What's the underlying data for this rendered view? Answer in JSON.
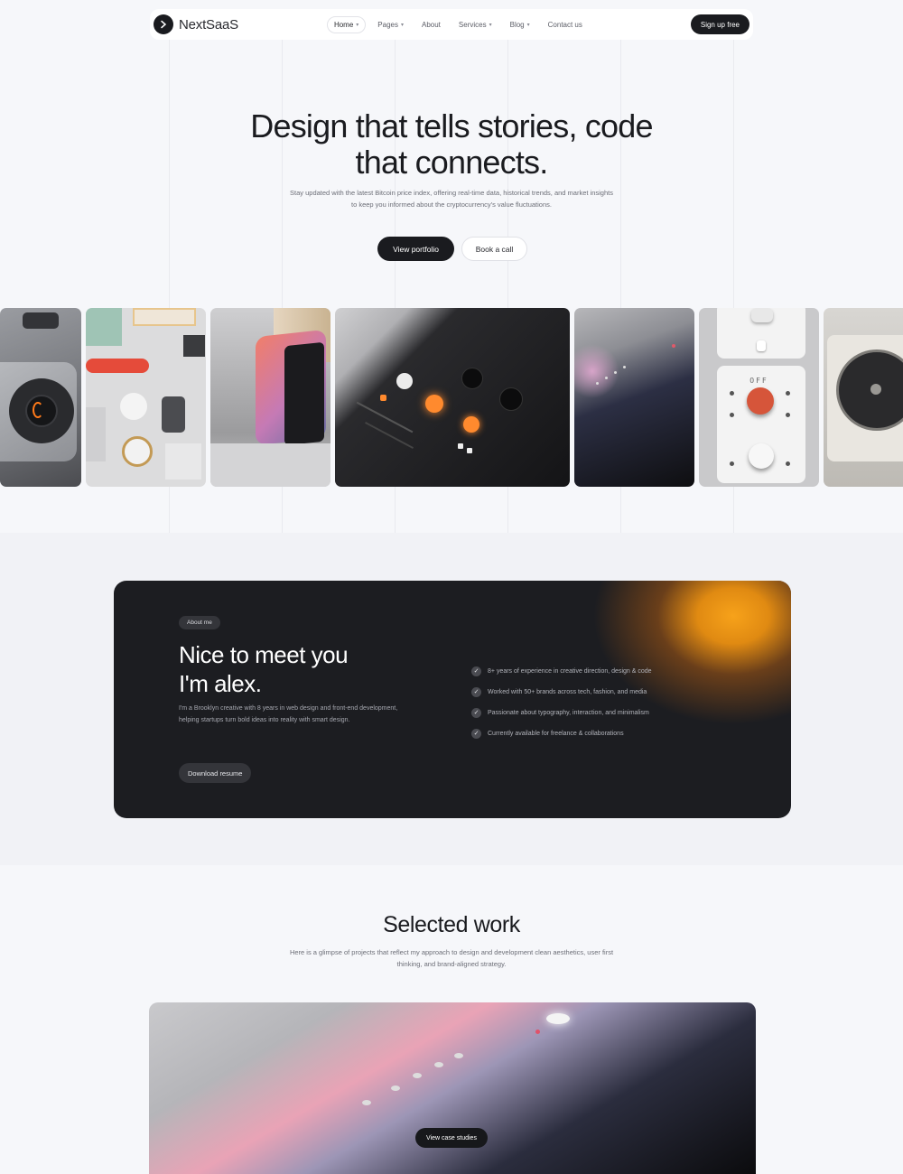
{
  "nav": {
    "logo_text": "NextSaaS",
    "items": [
      {
        "label": "Home",
        "has_dropdown": true,
        "active": true
      },
      {
        "label": "Pages",
        "has_dropdown": true
      },
      {
        "label": "About",
        "has_dropdown": false
      },
      {
        "label": "Services",
        "has_dropdown": true
      },
      {
        "label": "Blog",
        "has_dropdown": true
      },
      {
        "label": "Contact us",
        "has_dropdown": false
      }
    ],
    "cta_label": "Sign up free"
  },
  "hero": {
    "title_line1": "Design that tells stories, code",
    "title_line2": "that connects.",
    "subtitle": "Stay updated with the latest Bitcoin price index, offering real-time data, historical trends, and market insights to keep you informed about the cryptocurrency's value fluctuations.",
    "primary_button": "View portfolio",
    "secondary_button": "Book a call"
  },
  "gallery": {
    "tile7_label": "OFF"
  },
  "about": {
    "badge": "About me",
    "title_line1": "Nice to meet you",
    "title_line2": "I'm alex.",
    "description": "I'm a Brooklyn creative with 8 years in web design and front-end development, helping startups turn bold ideas into reality with smart design.",
    "button": "Download resume",
    "facts": [
      "8+ years of experience in creative direction, design & code",
      "Worked with 50+ brands across tech, fashion, and media",
      "Passionate about typography, interaction, and minimalism",
      "Currently available for freelance & collaborations"
    ]
  },
  "work": {
    "title": "Selected work",
    "subtitle": "Here is a glimpse of projects that reflect my approach to design and development clean aesthetics, user first thinking, and brand-aligned strategy.",
    "case_button": "View case studies"
  },
  "colors": {
    "ink": "#1a1b1f",
    "page_bg": "#f6f7fa",
    "card_dark": "#1c1d21",
    "accent_orange": "#f7a21a"
  }
}
